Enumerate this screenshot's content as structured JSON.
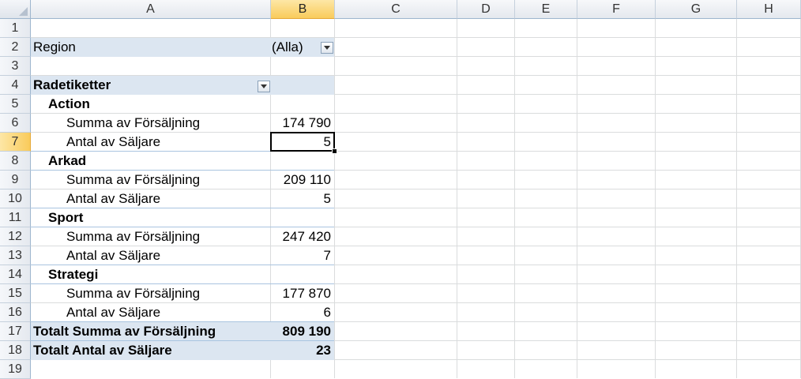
{
  "columns": [
    "A",
    "B",
    "C",
    "D",
    "E",
    "F",
    "G",
    "H"
  ],
  "rows": [
    "1",
    "2",
    "3",
    "4",
    "5",
    "6",
    "7",
    "8",
    "9",
    "10",
    "11",
    "12",
    "13",
    "14",
    "15",
    "16",
    "17",
    "18",
    "19"
  ],
  "selected_column": "B",
  "selected_row": "7",
  "filter": {
    "label": "Region",
    "value": "(Alla)"
  },
  "pivot": {
    "row_labels_header": "Radetiketter",
    "groups": [
      {
        "name": "Action",
        "sum_label": "Summa av Försäljning",
        "sum_value": "174 790",
        "count_label": "Antal av Säljare",
        "count_value": "5"
      },
      {
        "name": "Arkad",
        "sum_label": "Summa av Försäljning",
        "sum_value": "209 110",
        "count_label": "Antal av Säljare",
        "count_value": "5"
      },
      {
        "name": "Sport",
        "sum_label": "Summa av Försäljning",
        "sum_value": "247 420",
        "count_label": "Antal av Säljare",
        "count_value": "7"
      },
      {
        "name": "Strategi",
        "sum_label": "Summa av Försäljning",
        "sum_value": "177 870",
        "count_label": "Antal av Säljare",
        "count_value": "6"
      }
    ],
    "total_sum_label": "Totalt Summa av Försäljning",
    "total_sum_value": "809 190",
    "total_count_label": "Totalt Antal av Säljare",
    "total_count_value": "23"
  },
  "colors": {
    "pivot_band": "#dce6f1",
    "selection_header": "#f9cb5b",
    "gridline": "#dadcdd"
  },
  "icons": {
    "dropdown": "chevron-down-icon",
    "select_all": "select-all-triangle-icon"
  }
}
